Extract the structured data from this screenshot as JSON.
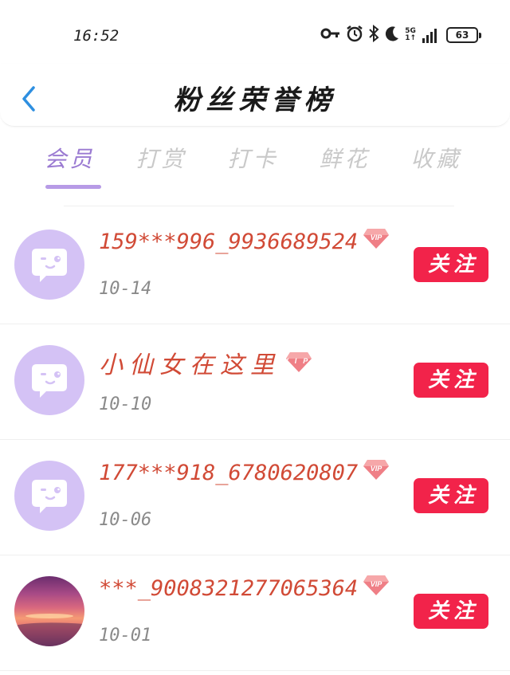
{
  "status_bar": {
    "time": "16:52",
    "network": "5G",
    "battery": "63",
    "icons": [
      "key-icon",
      "alarm-icon",
      "bluetooth-icon",
      "moon-icon",
      "signal-icon",
      "battery-icon"
    ]
  },
  "header": {
    "title": "粉丝荣誉榜",
    "back_icon": "chevron-left-icon",
    "accent_color": "#2e8fe0"
  },
  "tabs": [
    {
      "label": "会员",
      "active": true
    },
    {
      "label": "打赏",
      "active": false
    },
    {
      "label": "打卡",
      "active": false
    },
    {
      "label": "鲜花",
      "active": false
    },
    {
      "label": "收藏",
      "active": false
    }
  ],
  "colors": {
    "active_tab": "#9b7bd2",
    "inactive_tab": "#c9c9c9",
    "username": "#d14a36",
    "follow_button": "#f2234a",
    "avatar_default": "#d4c2f5"
  },
  "fans": [
    {
      "name": "159***996_9936689524",
      "date": "10-14",
      "vip": "VIP",
      "follow_label": "关注",
      "avatar": "default-chat-avatar"
    },
    {
      "name": "小仙女在这里",
      "date": "10-10",
      "vip": "VIP",
      "follow_label": "关注",
      "avatar": "default-chat-avatar"
    },
    {
      "name": "177***918_6780620807",
      "date": "10-06",
      "vip": "VIP",
      "follow_label": "关注",
      "avatar": "default-chat-avatar"
    },
    {
      "name": "***_9008321277065364",
      "date": "10-01",
      "vip": "VIP",
      "follow_label": "关注",
      "avatar": "sunset-photo-avatar"
    }
  ]
}
